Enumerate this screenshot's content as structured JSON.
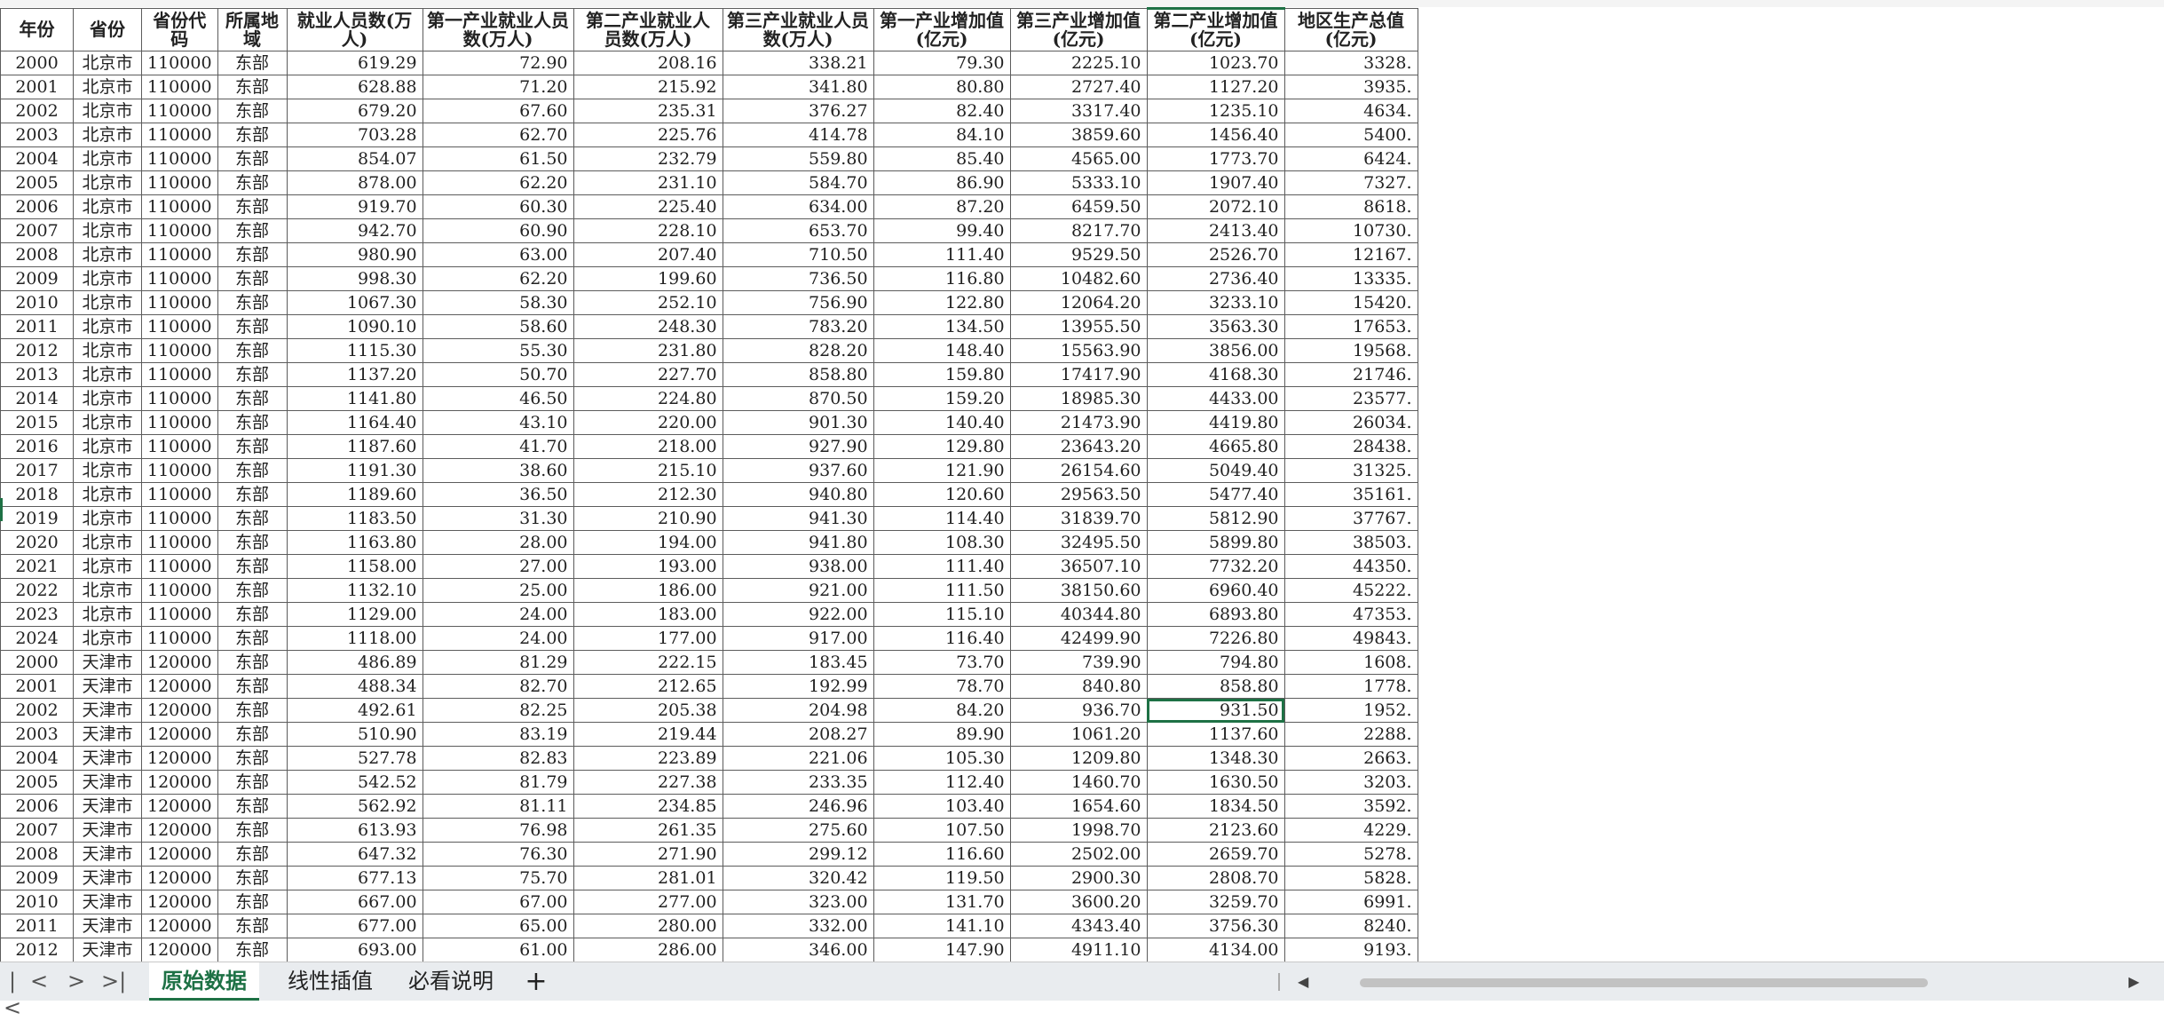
{
  "headers": [
    "年份",
    "省份",
    "省份代码",
    "所属地域",
    "就业人员数(万人)",
    "第一产业就业人员数(万人)",
    "第二产业就业人员数(万人)",
    "第三产业就业人员数(万人)",
    "第一产业增加值(亿元)",
    "第三产业增加值(亿元)",
    "第二产业增加值(亿元)",
    "地区生产总值(亿元)"
  ],
  "rows": [
    [
      "2000",
      "北京市",
      "110000",
      "东部",
      "619.29",
      "72.90",
      "208.16",
      "338.21",
      "79.30",
      "2225.10",
      "1023.70",
      "3328."
    ],
    [
      "2001",
      "北京市",
      "110000",
      "东部",
      "628.88",
      "71.20",
      "215.92",
      "341.80",
      "80.80",
      "2727.40",
      "1127.20",
      "3935."
    ],
    [
      "2002",
      "北京市",
      "110000",
      "东部",
      "679.20",
      "67.60",
      "235.31",
      "376.27",
      "82.40",
      "3317.40",
      "1235.10",
      "4634."
    ],
    [
      "2003",
      "北京市",
      "110000",
      "东部",
      "703.28",
      "62.70",
      "225.76",
      "414.78",
      "84.10",
      "3859.60",
      "1456.40",
      "5400."
    ],
    [
      "2004",
      "北京市",
      "110000",
      "东部",
      "854.07",
      "61.50",
      "232.79",
      "559.80",
      "85.40",
      "4565.00",
      "1773.70",
      "6424."
    ],
    [
      "2005",
      "北京市",
      "110000",
      "东部",
      "878.00",
      "62.20",
      "231.10",
      "584.70",
      "86.90",
      "5333.10",
      "1907.40",
      "7327."
    ],
    [
      "2006",
      "北京市",
      "110000",
      "东部",
      "919.70",
      "60.30",
      "225.40",
      "634.00",
      "87.20",
      "6459.50",
      "2072.10",
      "8618."
    ],
    [
      "2007",
      "北京市",
      "110000",
      "东部",
      "942.70",
      "60.90",
      "228.10",
      "653.70",
      "99.40",
      "8217.70",
      "2413.40",
      "10730."
    ],
    [
      "2008",
      "北京市",
      "110000",
      "东部",
      "980.90",
      "63.00",
      "207.40",
      "710.50",
      "111.40",
      "9529.50",
      "2526.70",
      "12167."
    ],
    [
      "2009",
      "北京市",
      "110000",
      "东部",
      "998.30",
      "62.20",
      "199.60",
      "736.50",
      "116.80",
      "10482.60",
      "2736.40",
      "13335."
    ],
    [
      "2010",
      "北京市",
      "110000",
      "东部",
      "1067.30",
      "58.30",
      "252.10",
      "756.90",
      "122.80",
      "12064.20",
      "3233.10",
      "15420."
    ],
    [
      "2011",
      "北京市",
      "110000",
      "东部",
      "1090.10",
      "58.60",
      "248.30",
      "783.20",
      "134.50",
      "13955.50",
      "3563.30",
      "17653."
    ],
    [
      "2012",
      "北京市",
      "110000",
      "东部",
      "1115.30",
      "55.30",
      "231.80",
      "828.20",
      "148.40",
      "15563.90",
      "3856.00",
      "19568."
    ],
    [
      "2013",
      "北京市",
      "110000",
      "东部",
      "1137.20",
      "50.70",
      "227.70",
      "858.80",
      "159.80",
      "17417.90",
      "4168.30",
      "21746."
    ],
    [
      "2014",
      "北京市",
      "110000",
      "东部",
      "1141.80",
      "46.50",
      "224.80",
      "870.50",
      "159.20",
      "18985.30",
      "4433.00",
      "23577."
    ],
    [
      "2015",
      "北京市",
      "110000",
      "东部",
      "1164.40",
      "43.10",
      "220.00",
      "901.30",
      "140.40",
      "21473.90",
      "4419.80",
      "26034."
    ],
    [
      "2016",
      "北京市",
      "110000",
      "东部",
      "1187.60",
      "41.70",
      "218.00",
      "927.90",
      "129.80",
      "23643.20",
      "4665.80",
      "28438."
    ],
    [
      "2017",
      "北京市",
      "110000",
      "东部",
      "1191.30",
      "38.60",
      "215.10",
      "937.60",
      "121.90",
      "26154.60",
      "5049.40",
      "31325."
    ],
    [
      "2018",
      "北京市",
      "110000",
      "东部",
      "1189.60",
      "36.50",
      "212.30",
      "940.80",
      "120.60",
      "29563.50",
      "5477.40",
      "35161."
    ],
    [
      "2019",
      "北京市",
      "110000",
      "东部",
      "1183.50",
      "31.30",
      "210.90",
      "941.30",
      "114.40",
      "31839.70",
      "5812.90",
      "37767."
    ],
    [
      "2020",
      "北京市",
      "110000",
      "东部",
      "1163.80",
      "28.00",
      "194.00",
      "941.80",
      "108.30",
      "32495.50",
      "5899.80",
      "38503."
    ],
    [
      "2021",
      "北京市",
      "110000",
      "东部",
      "1158.00",
      "27.00",
      "193.00",
      "938.00",
      "111.40",
      "36507.10",
      "7732.20",
      "44350."
    ],
    [
      "2022",
      "北京市",
      "110000",
      "东部",
      "1132.10",
      "25.00",
      "186.00",
      "921.00",
      "111.50",
      "38150.60",
      "6960.40",
      "45222."
    ],
    [
      "2023",
      "北京市",
      "110000",
      "东部",
      "1129.00",
      "24.00",
      "183.00",
      "922.00",
      "115.10",
      "40344.80",
      "6893.80",
      "47353."
    ],
    [
      "2024",
      "北京市",
      "110000",
      "东部",
      "1118.00",
      "24.00",
      "177.00",
      "917.00",
      "116.40",
      "42499.90",
      "7226.80",
      "49843."
    ],
    [
      "2000",
      "天津市",
      "120000",
      "东部",
      "486.89",
      "81.29",
      "222.15",
      "183.45",
      "73.70",
      "739.90",
      "794.80",
      "1608."
    ],
    [
      "2001",
      "天津市",
      "120000",
      "东部",
      "488.34",
      "82.70",
      "212.65",
      "192.99",
      "78.70",
      "840.80",
      "858.80",
      "1778."
    ],
    [
      "2002",
      "天津市",
      "120000",
      "东部",
      "492.61",
      "82.25",
      "205.38",
      "204.98",
      "84.20",
      "936.70",
      "931.50",
      "1952."
    ],
    [
      "2003",
      "天津市",
      "120000",
      "东部",
      "510.90",
      "83.19",
      "219.44",
      "208.27",
      "89.90",
      "1061.20",
      "1137.60",
      "2288."
    ],
    [
      "2004",
      "天津市",
      "120000",
      "东部",
      "527.78",
      "82.83",
      "223.89",
      "221.06",
      "105.30",
      "1209.80",
      "1348.30",
      "2663."
    ],
    [
      "2005",
      "天津市",
      "120000",
      "东部",
      "542.52",
      "81.79",
      "227.38",
      "233.35",
      "112.40",
      "1460.70",
      "1630.50",
      "3203."
    ],
    [
      "2006",
      "天津市",
      "120000",
      "东部",
      "562.92",
      "81.11",
      "234.85",
      "246.96",
      "103.40",
      "1654.60",
      "1834.50",
      "3592."
    ],
    [
      "2007",
      "天津市",
      "120000",
      "东部",
      "613.93",
      "76.98",
      "261.35",
      "275.60",
      "107.50",
      "1998.70",
      "2123.60",
      "4229."
    ],
    [
      "2008",
      "天津市",
      "120000",
      "东部",
      "647.32",
      "76.30",
      "271.90",
      "299.12",
      "116.60",
      "2502.00",
      "2659.70",
      "5278."
    ],
    [
      "2009",
      "天津市",
      "120000",
      "东部",
      "677.13",
      "75.70",
      "281.01",
      "320.42",
      "119.50",
      "2900.30",
      "2808.70",
      "5828."
    ],
    [
      "2010",
      "天津市",
      "120000",
      "东部",
      "667.00",
      "67.00",
      "277.00",
      "323.00",
      "131.70",
      "3600.20",
      "3259.70",
      "6991."
    ],
    [
      "2011",
      "天津市",
      "120000",
      "东部",
      "677.00",
      "65.00",
      "280.00",
      "332.00",
      "141.10",
      "4343.40",
      "3756.30",
      "8240."
    ],
    [
      "2012",
      "天津市",
      "120000",
      "东部",
      "693.00",
      "61.00",
      "286.00",
      "346.00",
      "147.90",
      "4911.10",
      "4134.00",
      "9193."
    ]
  ],
  "tabs": [
    "原始数据",
    "线性插值",
    "必看说明"
  ],
  "add_tab_label": "+",
  "nav_icons": [
    "first-sheet-icon",
    "prev-sheet-icon",
    "next-sheet-icon",
    "last-sheet-icon"
  ],
  "accent_color": "#1e7145"
}
